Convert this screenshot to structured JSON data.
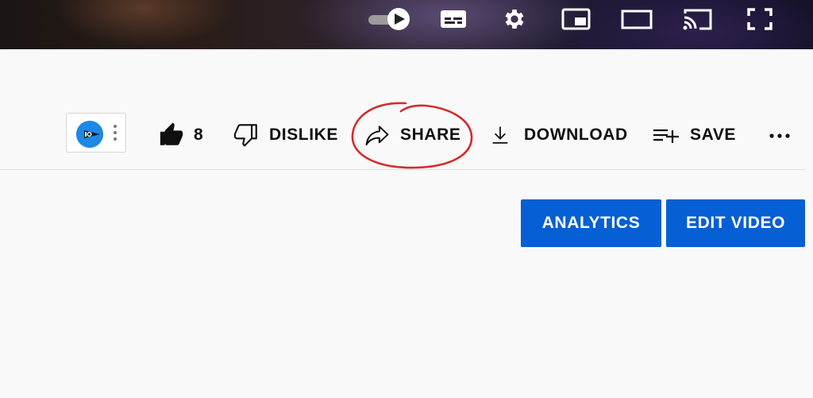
{
  "player": {
    "controls": [
      {
        "icon": "autoplay-toggle-icon"
      },
      {
        "icon": "subtitles-icon"
      },
      {
        "icon": "settings-gear-icon"
      },
      {
        "icon": "miniplayer-icon"
      },
      {
        "icon": "theater-mode-icon"
      },
      {
        "icon": "cast-icon"
      },
      {
        "icon": "fullscreen-icon"
      }
    ]
  },
  "actions": {
    "like_count": "8",
    "dislike_label": "DISLIKE",
    "share_label": "SHARE",
    "download_label": "DOWNLOAD",
    "save_label": "SAVE",
    "more_icon": "more-horizontal-icon",
    "share_highlight_color": "#d62b2b"
  },
  "owner_buttons": {
    "analytics_label": "ANALYTICS",
    "edit_video_label": "EDIT VIDEO",
    "color": "#065fd4"
  }
}
